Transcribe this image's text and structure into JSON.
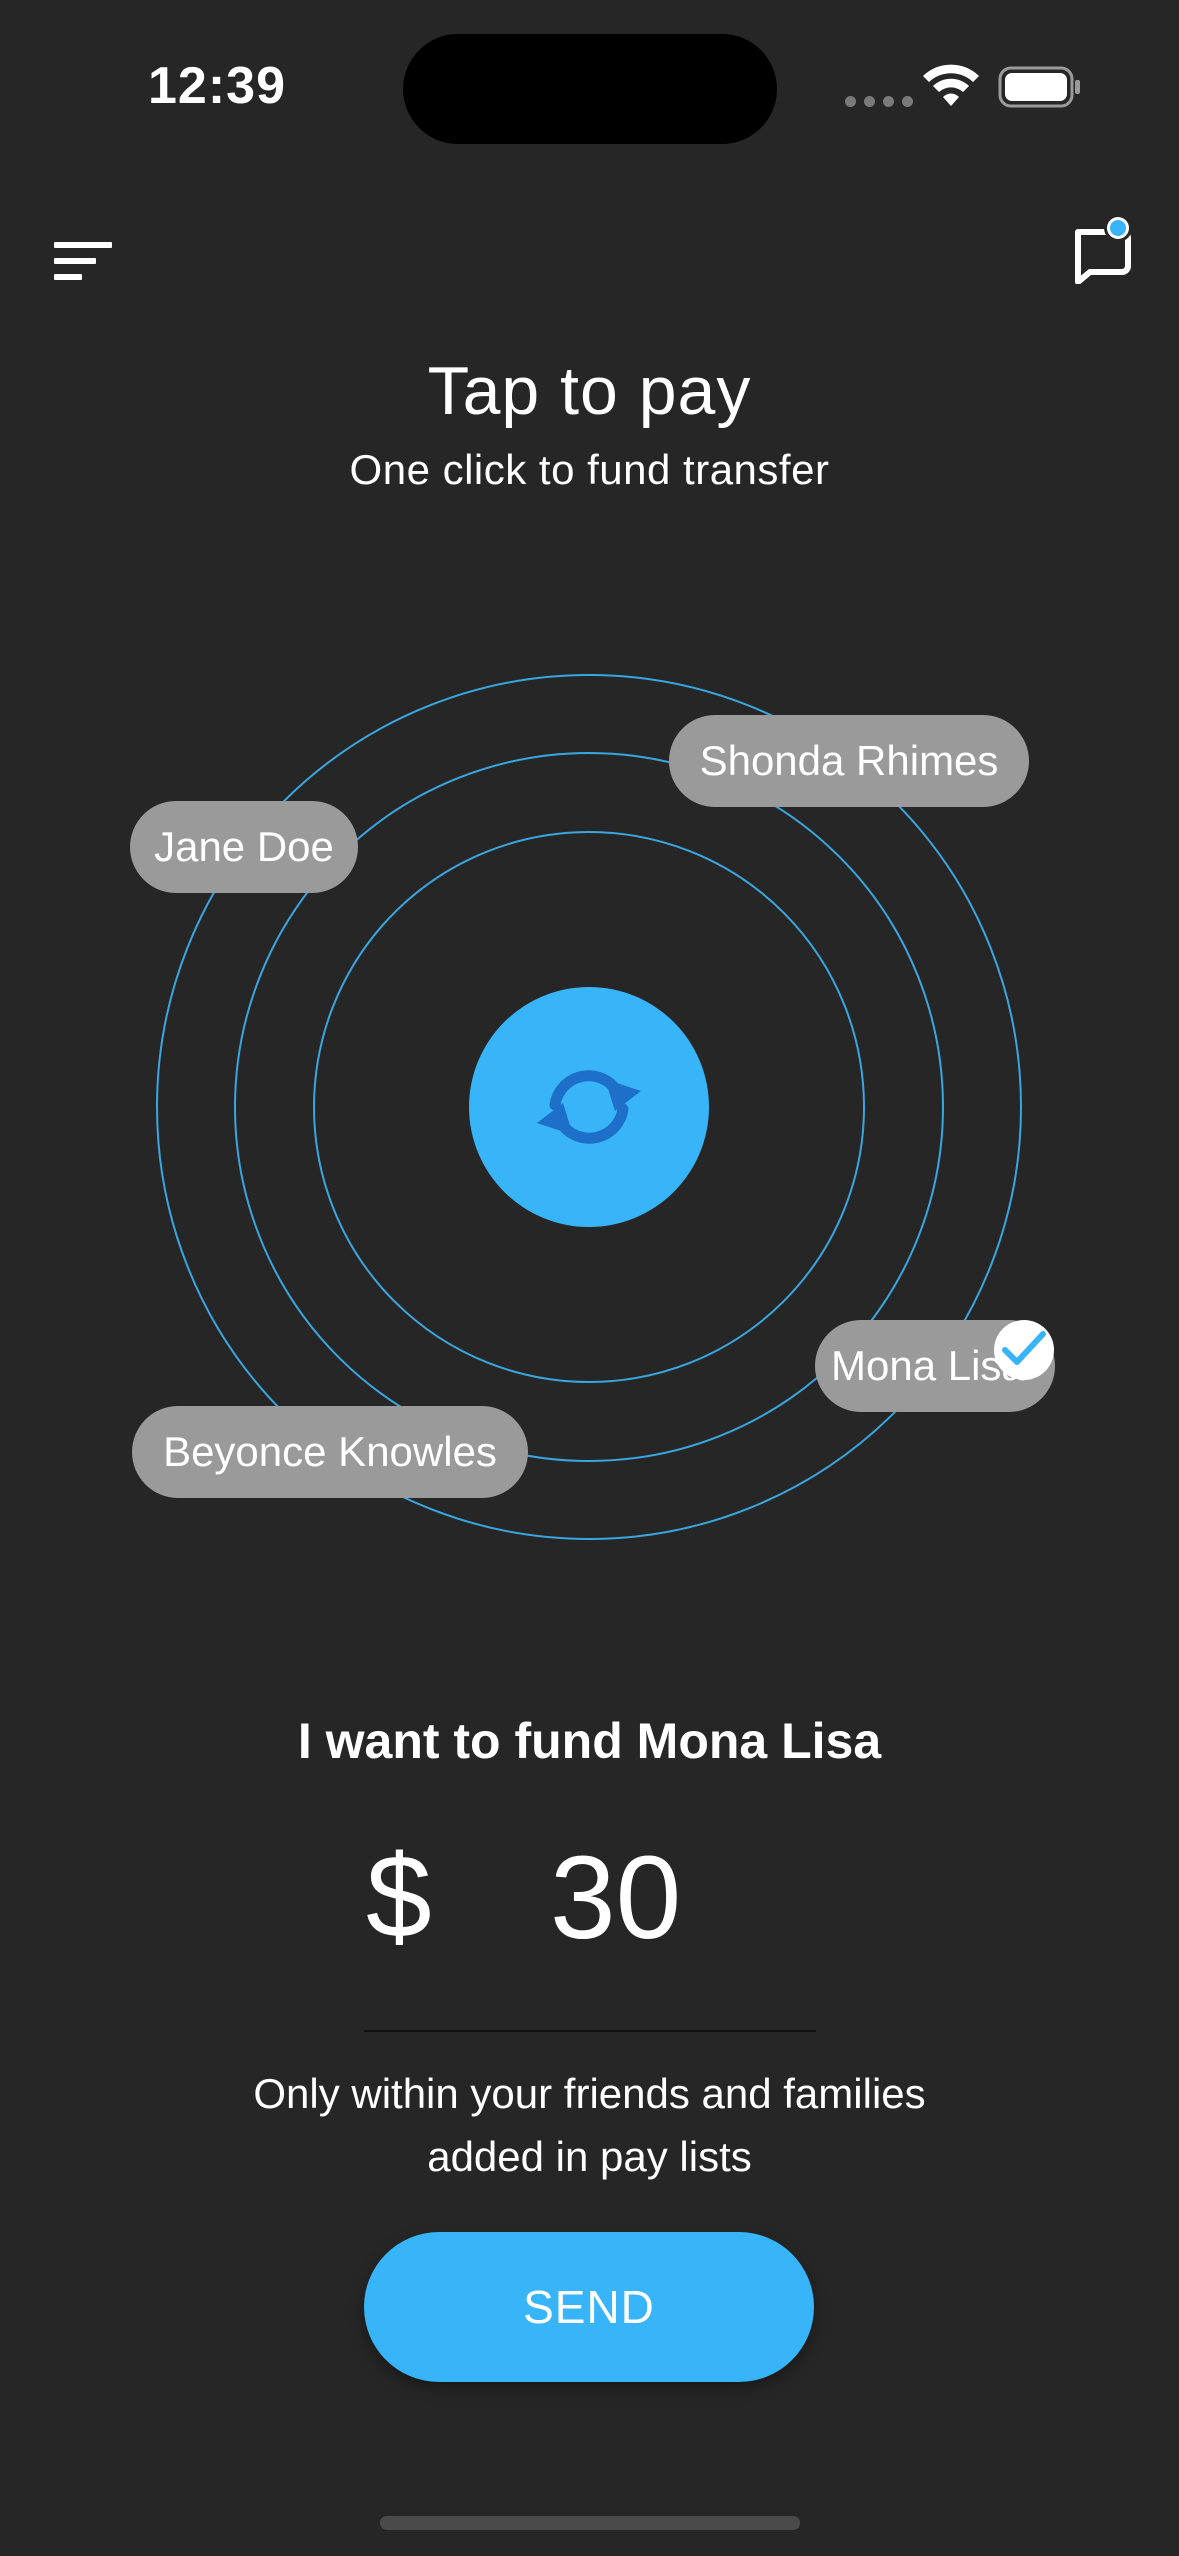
{
  "status_bar": {
    "time": "12:39"
  },
  "header": {
    "menu_icon": "menu-lines-icon",
    "chat_icon": "chat-notification-icon"
  },
  "title": "Tap to pay",
  "subtitle": "One click to fund transfer",
  "radar": {
    "center_icon": "refresh-icon",
    "contacts": [
      {
        "name": "Shonda Rhimes",
        "selected": false
      },
      {
        "name": "Jane Doe",
        "selected": false
      },
      {
        "name": "Mona Lisa",
        "selected": true
      },
      {
        "name": "Beyonce Knowles",
        "selected": false
      }
    ]
  },
  "fund": {
    "label": "I want to fund Mona Lisa",
    "currency": "$",
    "amount": "30",
    "note_line1": "Only within your friends and families",
    "note_line2": "added in pay lists",
    "send_label": "SEND"
  },
  "colors": {
    "background": "#262626",
    "accent": "#38b4f8",
    "chip": "#9a9a9a",
    "ring": "#3aa6e0"
  }
}
